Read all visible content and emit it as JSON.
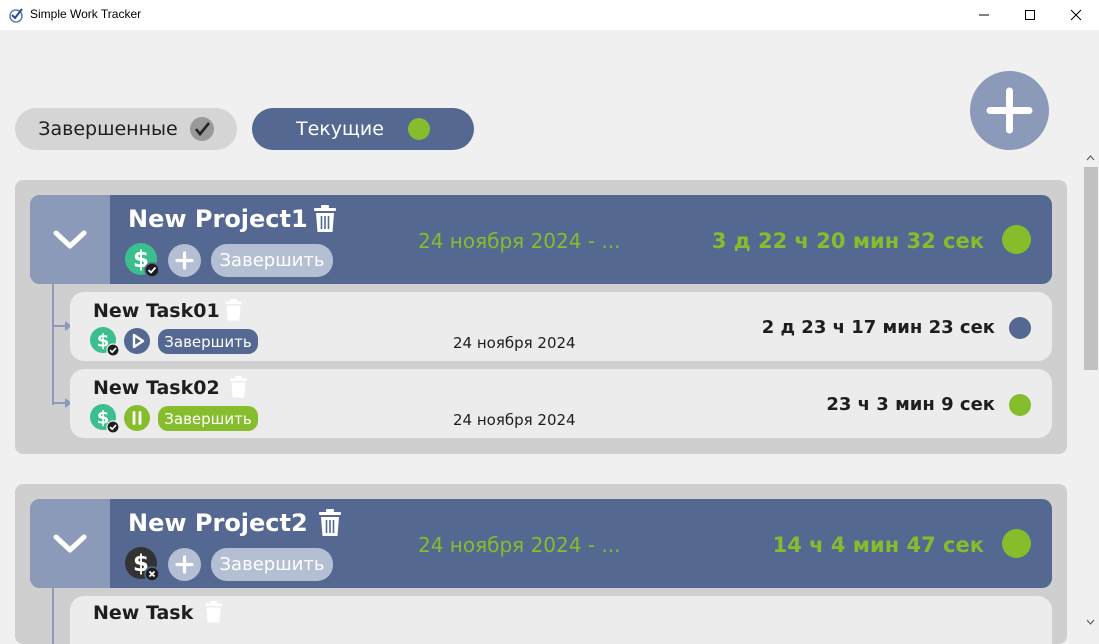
{
  "window": {
    "title": "Simple Work Tracker"
  },
  "filters": {
    "completed_label": "Завершенные",
    "current_label": "Текущие"
  },
  "colors": {
    "accent_blue": "#546892",
    "light_blue": "#8a9ab8",
    "active_green": "#86bd2c",
    "paid_teal": "#3bbf8e",
    "unpaid_dark": "#333333",
    "stopped_blue": "#546892"
  },
  "projects": [
    {
      "name": "New Project1",
      "date_range": "24 ноября 2024 - ...",
      "elapsed": "3 д 22 ч 20 мин 32 сек",
      "status": "active",
      "paid": true,
      "finish_label": "Завершить",
      "tasks": [
        {
          "name": "New Task01",
          "date": "24 ноября 2024",
          "elapsed": "2 д 23 ч 17 мин 23 сек",
          "status": "stopped",
          "paid": true,
          "control": "play",
          "finish_label": "Завершить"
        },
        {
          "name": "New Task02",
          "date": "24 ноября 2024",
          "elapsed": "23 ч 3 мин 9 сек",
          "status": "running",
          "paid": true,
          "control": "pause",
          "finish_label": "Завершить"
        }
      ]
    },
    {
      "name": "New Project2",
      "date_range": "24 ноября 2024 - ...",
      "elapsed": "14 ч 4 мин 47 сек",
      "status": "active",
      "paid": false,
      "finish_label": "Завершить",
      "tasks": [
        {
          "name": "New Task"
        }
      ]
    }
  ],
  "icons": {
    "app": "checkmark-app-icon",
    "minimize": "minimize-icon",
    "maximize": "maximize-icon",
    "close": "close-icon",
    "add_project": "plus-icon",
    "collapse": "chevron-down-icon",
    "delete": "trash-icon",
    "paid": "dollar-check-icon",
    "unpaid": "dollar-x-icon",
    "play": "play-icon",
    "pause": "pause-icon"
  }
}
